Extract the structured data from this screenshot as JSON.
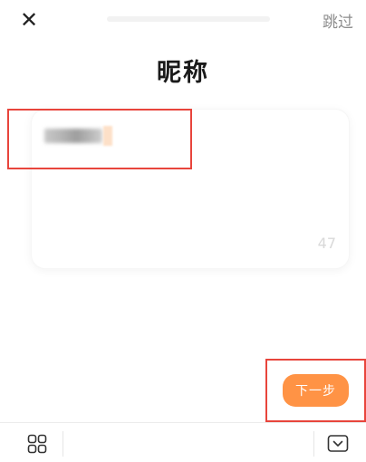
{
  "top_bar": {
    "close_glyph": "✕",
    "skip_label": "跳过",
    "progress_fraction": 0
  },
  "page": {
    "title": "昵称"
  },
  "nickname_field": {
    "value": "",
    "char_counter": "47"
  },
  "next_button": {
    "label": "下一步"
  },
  "keyboard_toolbar": {
    "left_icon": "grid-icon",
    "right_icon": "keyboard-hide-icon"
  },
  "colors": {
    "accent": "#ff9345",
    "highlight_border": "#e8453c",
    "muted_text": "#8d8d8d",
    "counter_text": "#d9d9d9"
  }
}
